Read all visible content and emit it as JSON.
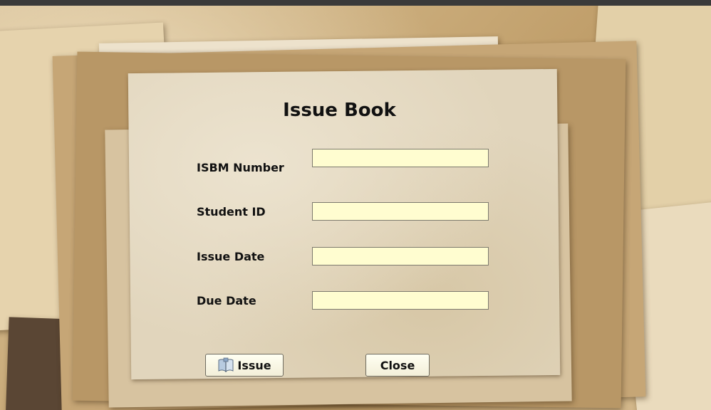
{
  "window": {
    "title": "Issue Book"
  },
  "form": {
    "fields": [
      {
        "label": "ISBM Number",
        "value": ""
      },
      {
        "label": "Student ID",
        "value": ""
      },
      {
        "label": "Issue Date",
        "value": ""
      },
      {
        "label": "Due Date",
        "value": ""
      }
    ]
  },
  "buttons": {
    "issue": {
      "label": "Issue",
      "icon": "book-icon"
    },
    "close": {
      "label": "Close"
    }
  },
  "colors": {
    "field_background": "#fffdd0",
    "panel_background": "#e1d5bc",
    "text": "#111111"
  }
}
